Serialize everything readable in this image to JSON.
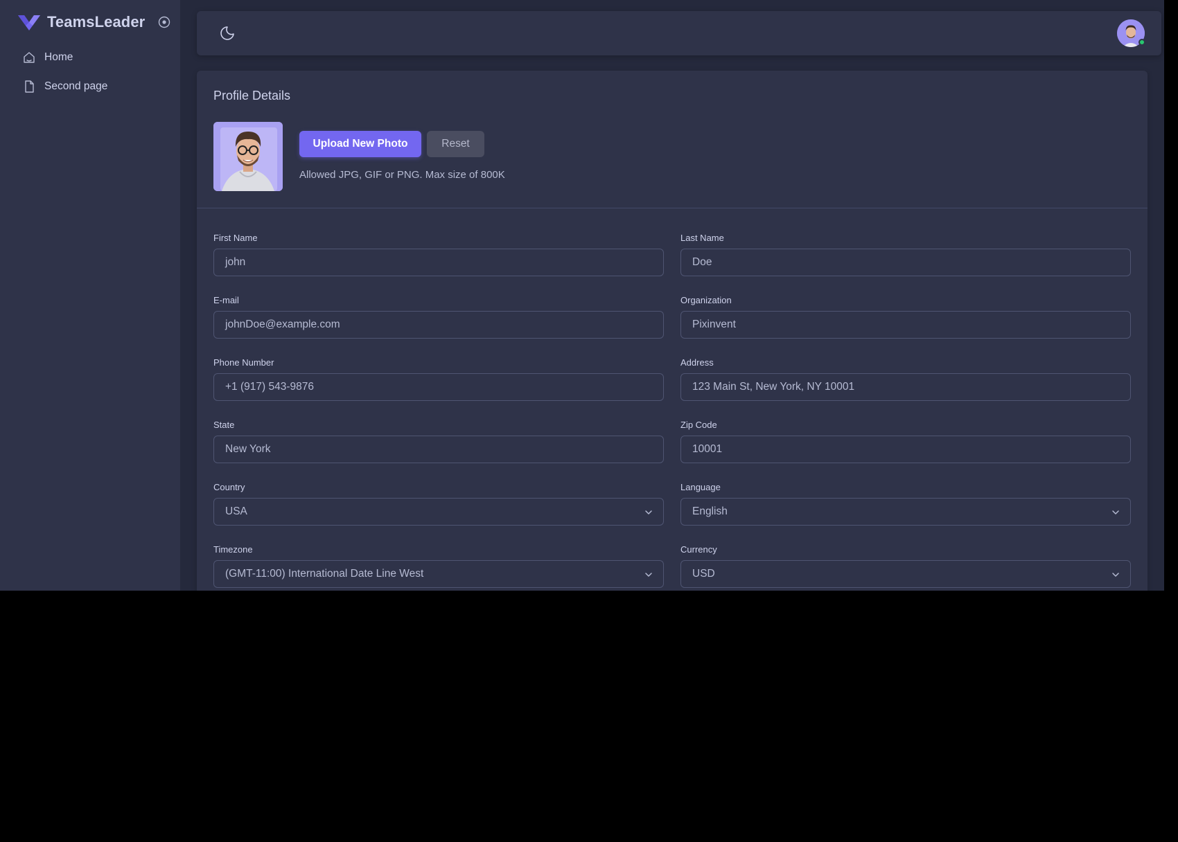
{
  "app": {
    "name": "TeamsLeader"
  },
  "sidebar": {
    "items": [
      {
        "label": "Home",
        "icon": "home-icon"
      },
      {
        "label": "Second page",
        "icon": "file-icon"
      }
    ]
  },
  "topbar": {
    "theme_icon": "moon-icon",
    "status": "online"
  },
  "profile": {
    "title": "Profile Details",
    "upload_label": "Upload New Photo",
    "reset_label": "Reset",
    "hint": "Allowed JPG, GIF or PNG. Max size of 800K"
  },
  "form": {
    "first_name": {
      "label": "First Name",
      "value": "john"
    },
    "last_name": {
      "label": "Last Name",
      "value": "Doe"
    },
    "email": {
      "label": "E-mail",
      "value": "johnDoe@example.com"
    },
    "organization": {
      "label": "Organization",
      "value": "Pixinvent"
    },
    "phone": {
      "label": "Phone Number",
      "value": "+1 (917) 543-9876"
    },
    "address": {
      "label": "Address",
      "value": "123 Main St, New York, NY 10001"
    },
    "state": {
      "label": "State",
      "value": "New York"
    },
    "zip": {
      "label": "Zip Code",
      "value": "10001"
    },
    "country": {
      "label": "Country",
      "value": "USA"
    },
    "language": {
      "label": "Language",
      "value": "English"
    },
    "timezone": {
      "label": "Timezone",
      "value": "(GMT-11:00) International Date Line West"
    },
    "currency": {
      "label": "Currency",
      "value": "USD"
    }
  },
  "colors": {
    "primary": "#7367f0",
    "background": "#25293c",
    "surface": "#2f3349",
    "success": "#28c76f"
  }
}
